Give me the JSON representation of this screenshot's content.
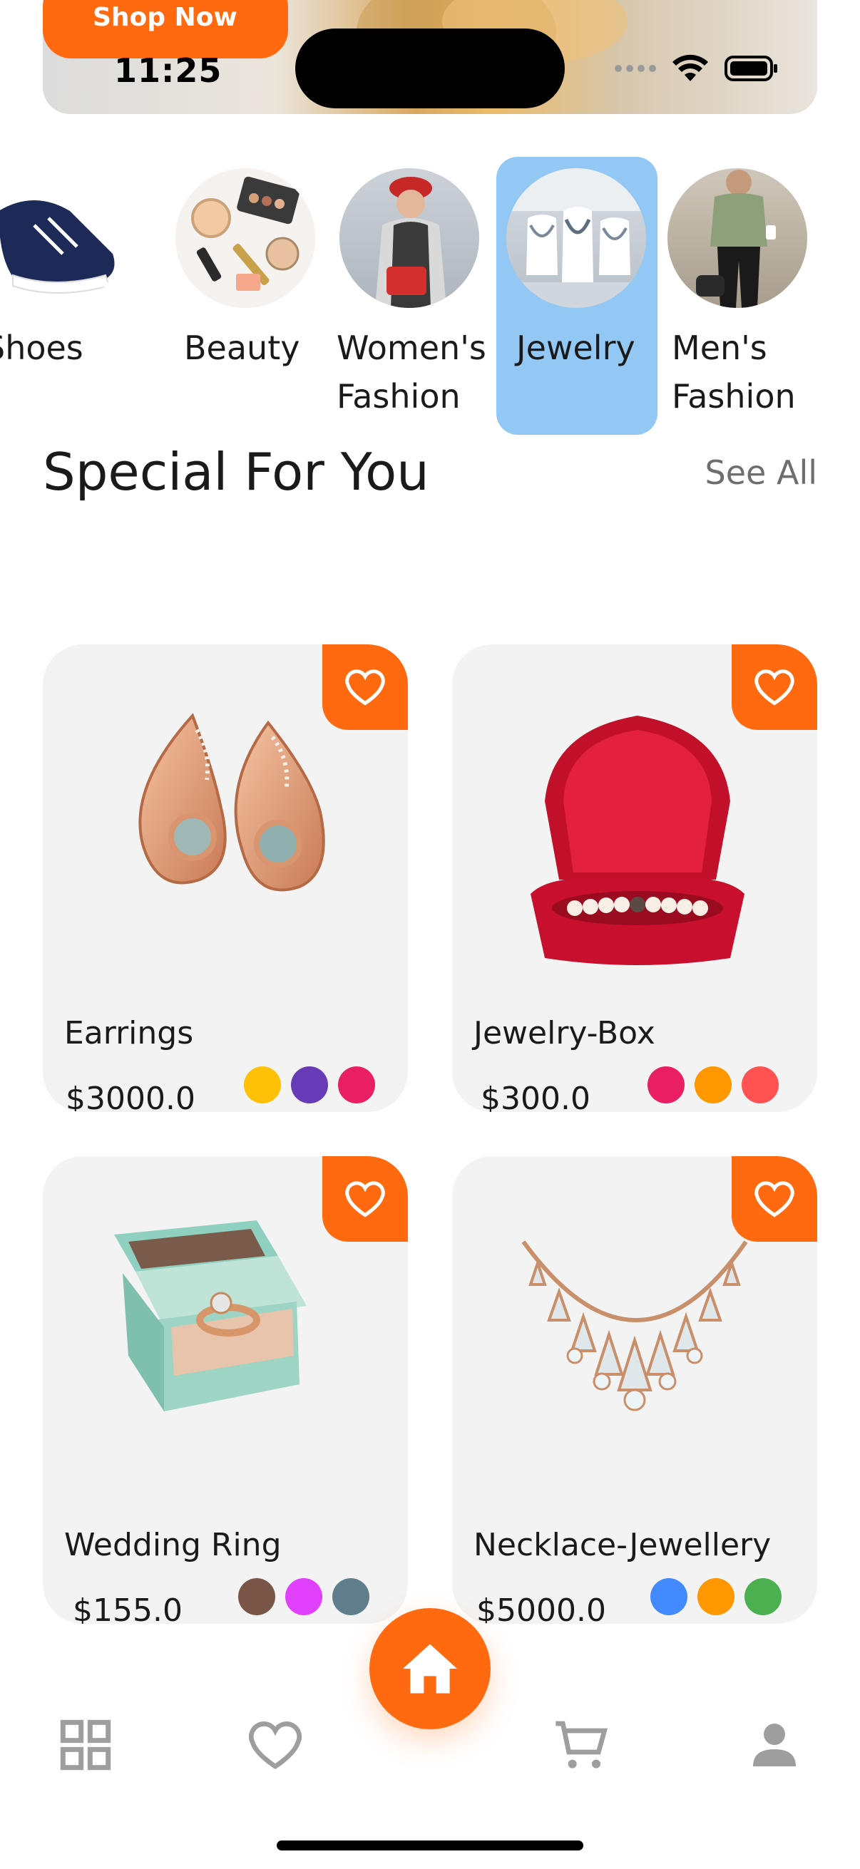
{
  "status_bar": {
    "time": "11:25"
  },
  "banner": {
    "cta_label": "Shop Now"
  },
  "categories": [
    {
      "label": "Shoes",
      "selected": false
    },
    {
      "label": "Beauty",
      "selected": false
    },
    {
      "label": "Women's\nFashion",
      "selected": false
    },
    {
      "label": "Jewelry",
      "selected": true
    },
    {
      "label": "Men's\nFashion",
      "selected": false
    }
  ],
  "section": {
    "title": "Special For You",
    "see_all": "See All"
  },
  "products": [
    {
      "name": "Earrings",
      "price": "$3000.0",
      "colors": [
        "#ffc107",
        "#673ab7",
        "#e91e63"
      ]
    },
    {
      "name": "Jewelry-Box",
      "price": "$300.0",
      "colors": [
        "#e91e63",
        "#ff9800",
        "#ff5252"
      ]
    },
    {
      "name": "Wedding Ring",
      "price": "$155.0",
      "colors": [
        "#795548",
        "#e040fb",
        "#607d8b"
      ]
    },
    {
      "name": "Necklace-Jewellery",
      "price": "$5000.0",
      "colors": [
        "#448aff",
        "#ff9800",
        "#4caf50"
      ]
    }
  ],
  "theme": {
    "accent": "#ff6a10",
    "selected_category": "#93c8f5",
    "card_bg": "#f3f3f3",
    "nav_icon": "#9e9e9e"
  },
  "bottom_nav": [
    "grid-icon",
    "heart-icon",
    "home-icon",
    "cart-icon",
    "person-icon"
  ]
}
